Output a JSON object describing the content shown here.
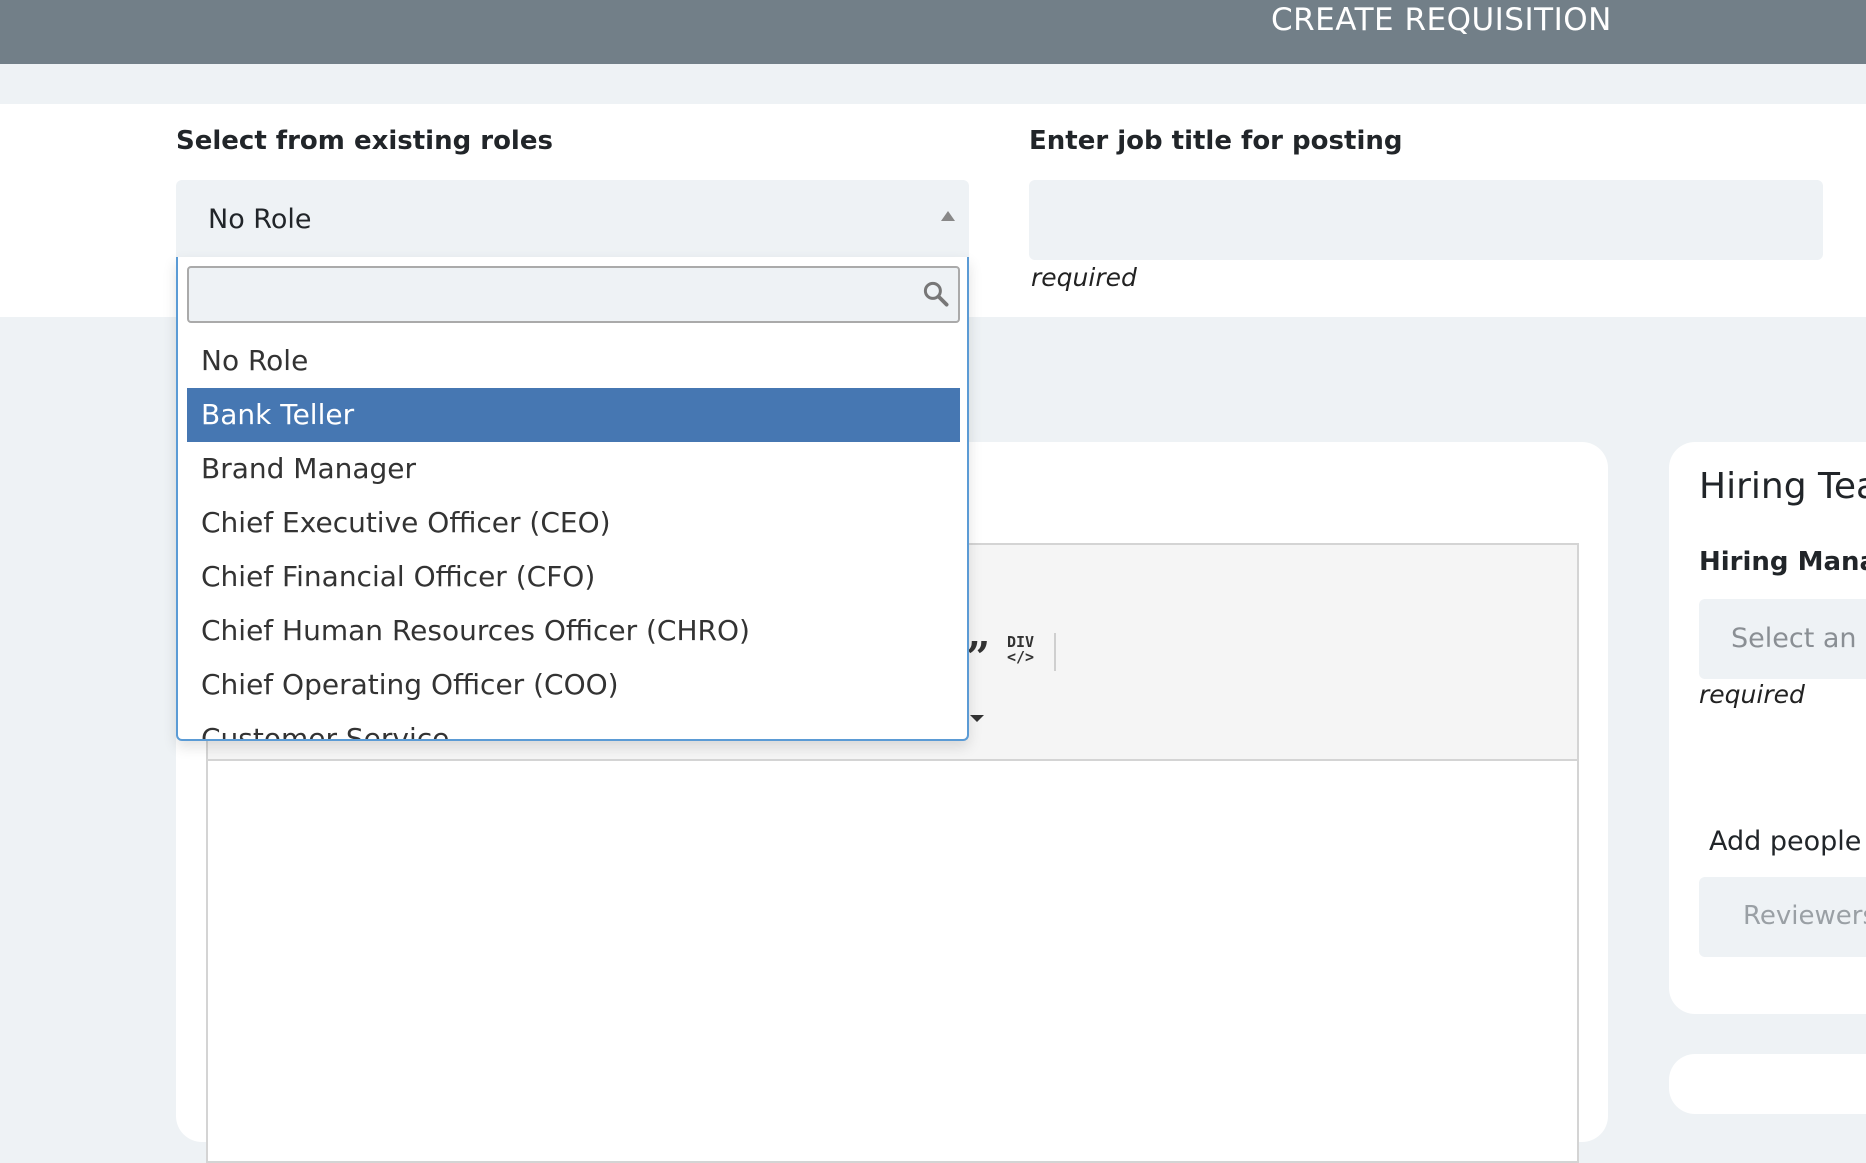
{
  "header": {
    "action_label": "CREATE REQUISITION",
    "bar_color": "#727f88"
  },
  "role_section": {
    "existing_roles_label": "Select from existing roles",
    "selected_role": "No Role",
    "job_title_label": "Enter job title for posting",
    "job_title_value": "",
    "job_title_hint": "required"
  },
  "role_dropdown": {
    "search_value": "",
    "search_icon": "search-icon",
    "highlighted_index": 1,
    "highlight_color": "#4677b2",
    "options": [
      "No Role",
      "Bank Teller",
      "Brand Manager",
      "Chief Executive Officer (CEO)",
      "Chief Financial Officer (CFO)",
      "Chief Human Resources Officer (CHRO)",
      "Chief Operating Officer (COO)",
      "Customer Service"
    ]
  },
  "editor_toolbar": {
    "quote_icon": "quote-icon",
    "div_icon_label_top": "DIV",
    "div_icon_label_bottom": "</>"
  },
  "hiring_team": {
    "title": "Hiring Tea",
    "manager_label": "Hiring Manag",
    "manager_placeholder": "Select an o",
    "manager_hint": "required",
    "add_people_text": "Add people v",
    "reviewers_placeholder": "Reviewers"
  }
}
